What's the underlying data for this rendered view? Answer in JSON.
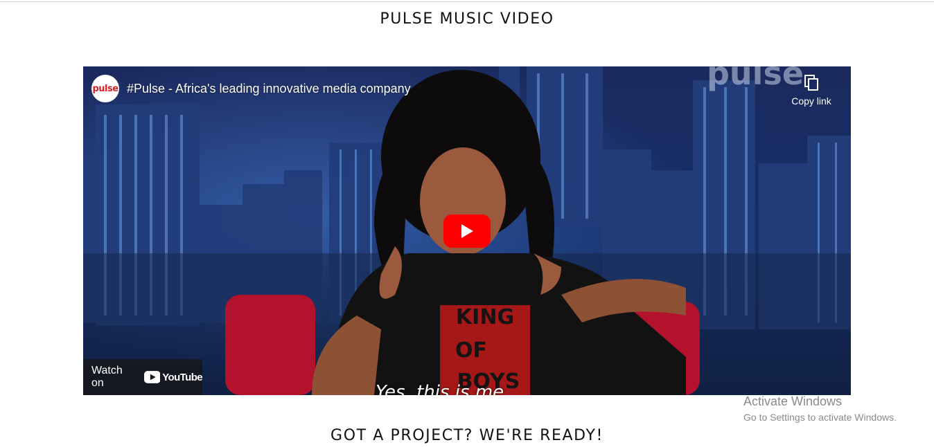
{
  "page": {
    "top_title": "PULSE MUSIC VIDEO",
    "bottom_title": "GOT A PROJECT? WE'RE READY!"
  },
  "video": {
    "channel_logo_text": "pulse",
    "title": "#Pulse - Africa's leading innovative media company",
    "copy_link_label": "Copy link",
    "watch_on_label": "Watch on",
    "youtube_label": "YouTube",
    "caption": "Yes, this is me",
    "watermark": "pulse",
    "shirt_text": [
      "KING",
      "OF",
      "BOYS"
    ],
    "icons": {
      "copy": "copy-icon",
      "play": "play-icon",
      "youtube": "youtube-logo-icon"
    },
    "colors": {
      "play_button": "#ff0000",
      "logo_red": "#d51f26"
    }
  },
  "os_overlay": {
    "line1": "Activate Windows",
    "line2": "Go to Settings to activate Windows."
  }
}
